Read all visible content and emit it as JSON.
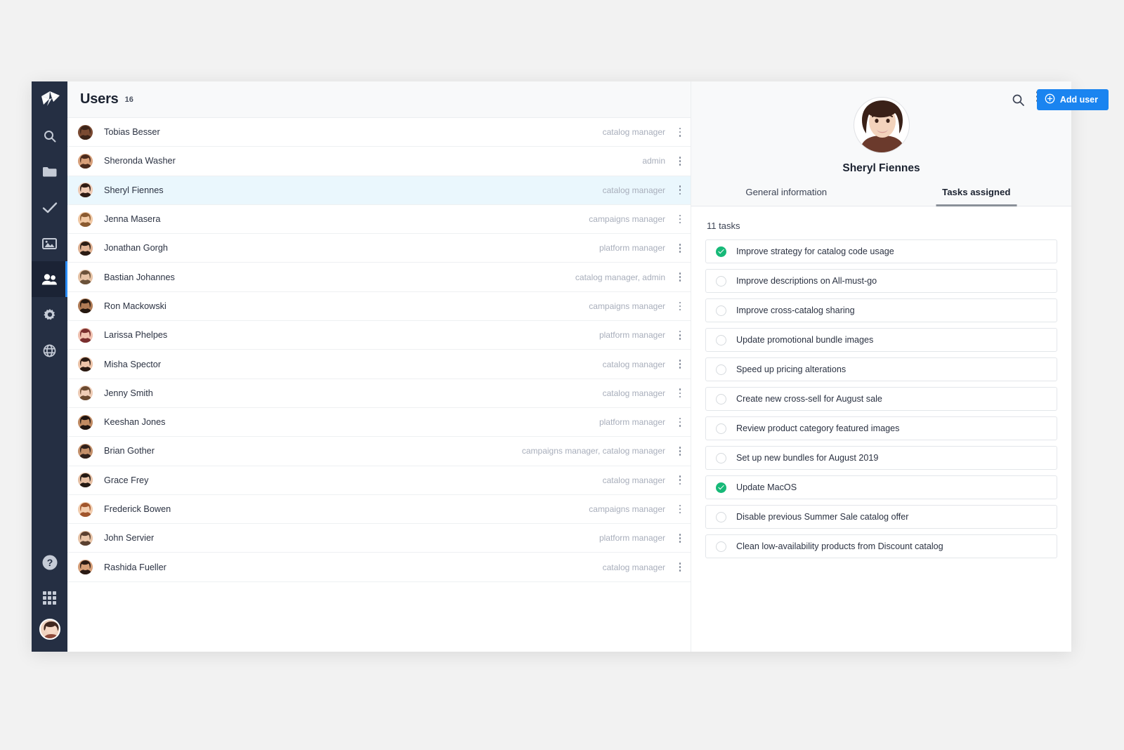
{
  "sidebar": {
    "logo_icon": "origami-logo-icon",
    "items": [
      {
        "icon": "search-icon",
        "name": "sidebar-item-search",
        "active": false
      },
      {
        "icon": "folder-icon",
        "name": "sidebar-item-folders",
        "active": false
      },
      {
        "icon": "check-icon",
        "name": "sidebar-item-tasks",
        "active": false
      },
      {
        "icon": "image-icon",
        "name": "sidebar-item-media",
        "active": false
      },
      {
        "icon": "users-icon",
        "name": "sidebar-item-users",
        "active": true
      },
      {
        "icon": "gear-icon",
        "name": "sidebar-item-settings",
        "active": false
      },
      {
        "icon": "globe-icon",
        "name": "sidebar-item-globe",
        "active": false
      }
    ],
    "bottom_items": [
      {
        "icon": "help-icon",
        "name": "sidebar-item-help"
      },
      {
        "icon": "grid-apps-icon",
        "name": "sidebar-item-apps"
      },
      {
        "icon": "avatar",
        "name": "sidebar-current-user-avatar"
      }
    ]
  },
  "header": {
    "title": "Users",
    "count": "16",
    "search_icon": "search-icon",
    "add_user_label": "Add user",
    "add_user_icon": "plus-circle-icon",
    "accent_color": "#1a84f0"
  },
  "users": [
    {
      "name": "Tobias Besser",
      "role": "catalog manager",
      "selected": false
    },
    {
      "name": "Sheronda Washer",
      "role": "admin",
      "selected": false
    },
    {
      "name": "Sheryl Fiennes",
      "role": "catalog manager",
      "selected": true
    },
    {
      "name": "Jenna Masera",
      "role": "campaigns manager",
      "selected": false
    },
    {
      "name": "Jonathan Gorgh",
      "role": "platform manager",
      "selected": false
    },
    {
      "name": "Bastian Johannes",
      "role": "catalog manager, admin",
      "selected": false
    },
    {
      "name": "Ron Mackowski",
      "role": "campaigns manager",
      "selected": false
    },
    {
      "name": "Larissa Phelpes",
      "role": "platform manager",
      "selected": false
    },
    {
      "name": "Misha Spector",
      "role": "catalog manager",
      "selected": false
    },
    {
      "name": "Jenny Smith",
      "role": "catalog manager",
      "selected": false
    },
    {
      "name": "Keeshan Jones",
      "role": "platform manager",
      "selected": false
    },
    {
      "name": "Brian Gother",
      "role": "campaigns manager, catalog manager",
      "selected": false
    },
    {
      "name": "Grace Frey",
      "role": "catalog manager",
      "selected": false
    },
    {
      "name": "Frederick Bowen",
      "role": "campaigns manager",
      "selected": false
    },
    {
      "name": "John Servier",
      "role": "platform manager",
      "selected": false
    },
    {
      "name": "Rashida Fueller",
      "role": "catalog manager",
      "selected": false
    }
  ],
  "detail": {
    "user_name": "Sheryl Fiennes",
    "avatar_name": "detail-avatar",
    "kebab_icon": "more-vertical-icon",
    "close_icon": "close-icon",
    "tabs": [
      {
        "label": "General information",
        "active": false
      },
      {
        "label": "Tasks assigned",
        "active": true
      }
    ],
    "tasks_count_label": "11 tasks",
    "done_color": "#17b978",
    "tasks": [
      {
        "label": "Improve strategy for catalog code usage",
        "done": true
      },
      {
        "label": "Improve descriptions on All-must-go",
        "done": false
      },
      {
        "label": "Improve cross-catalog sharing",
        "done": false
      },
      {
        "label": "Update promotional bundle images",
        "done": false
      },
      {
        "label": "Speed up pricing alterations",
        "done": false
      },
      {
        "label": "Create new cross-sell for August sale",
        "done": false
      },
      {
        "label": "Review product category featured images",
        "done": false
      },
      {
        "label": "Set up new bundles for August 2019",
        "done": false
      },
      {
        "label": "Update MacOS",
        "done": true
      },
      {
        "label": "Disable previous Summer Sale catalog offer",
        "done": false
      },
      {
        "label": "Clean low-availability products from Discount catalog",
        "done": false
      }
    ]
  }
}
